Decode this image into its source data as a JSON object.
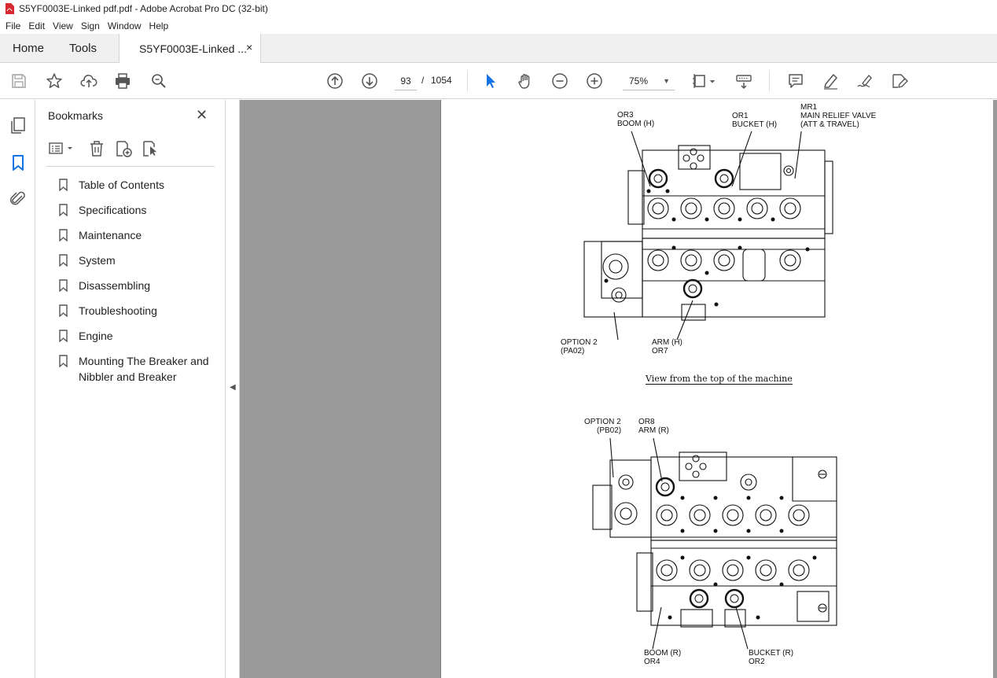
{
  "window": {
    "title": "S5YF0003E-Linked pdf.pdf - Adobe Acrobat Pro DC (32-bit)"
  },
  "menu": [
    "File",
    "Edit",
    "View",
    "Sign",
    "Window",
    "Help"
  ],
  "tabs": {
    "home": "Home",
    "tools": "Tools",
    "document": "S5YF0003E-Linked ...",
    "close": "×"
  },
  "toolbar": {
    "page_current": "93",
    "page_separator": "/",
    "page_total": "1054",
    "zoom": "75%"
  },
  "bookmarks": {
    "title": "Bookmarks",
    "close": "✕",
    "items": [
      "Table of Contents",
      "Specifications",
      "Maintenance",
      "System",
      "Disassembling",
      "Troubleshooting",
      "Engine",
      "Mounting The Breaker and Nibbler and Breaker"
    ]
  },
  "document": {
    "top_labels": {
      "or3_a": "OR3",
      "or3_b": "BOOM (H)",
      "or1_a": "OR1",
      "or1_b": "BUCKET (H)",
      "mr1_a": "MR1",
      "mr1_b": "MAIN RELIEF VALVE",
      "mr1_c": "(ATT & TRAVEL)",
      "opt2_a": "OPTION 2",
      "opt2_b": "(PA02)",
      "arm_a": "ARM (H)",
      "arm_b": "OR7"
    },
    "caption": "View from the top of the machine",
    "bottom_labels": {
      "opt2_a": "OPTION 2",
      "opt2_b": "(PB02)",
      "or8_a": "OR8",
      "or8_b": "ARM (R)",
      "boom_a": "BOOM (R)",
      "boom_b": "OR4",
      "bucket_a": "BUCKET (R)",
      "bucket_b": "OR2"
    }
  },
  "colors": {
    "accent_blue": "#1473e6",
    "pdf_red": "#d7282f",
    "doc_bg": "#9a9a9a"
  }
}
